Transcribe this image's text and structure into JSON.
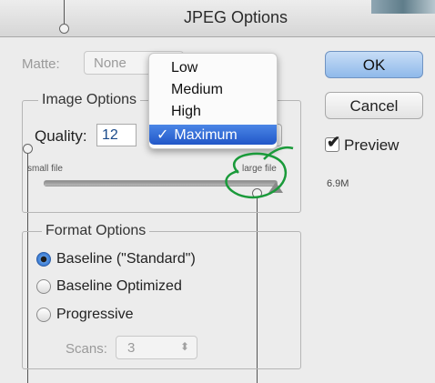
{
  "window": {
    "title": "JPEG Options"
  },
  "matte": {
    "label": "Matte:",
    "value": "None"
  },
  "image_options": {
    "group_title": "Image Options",
    "quality_label": "Quality:",
    "quality_value": "12",
    "quality_menu": {
      "items": [
        "Low",
        "Medium",
        "High",
        "Maximum"
      ],
      "selected": "Maximum",
      "check": "✓"
    },
    "slider_min_label": "small file",
    "slider_max_label": "large file",
    "slider_level": 1.0
  },
  "format_options": {
    "group_title": "Format Options",
    "options": [
      "Baseline (\"Standard\")",
      "Baseline Optimized",
      "Progressive"
    ],
    "selected_index": 0,
    "scans_label": "Scans:",
    "scans_value": "3"
  },
  "buttons": {
    "ok": "OK",
    "cancel": "Cancel"
  },
  "preview": {
    "label": "Preview",
    "checked": true,
    "file_size": "6.9M"
  },
  "colors": {
    "accent": "#2f6fcb",
    "annotation": "#1a9a3a",
    "ok_button": "#9cc2ee"
  }
}
